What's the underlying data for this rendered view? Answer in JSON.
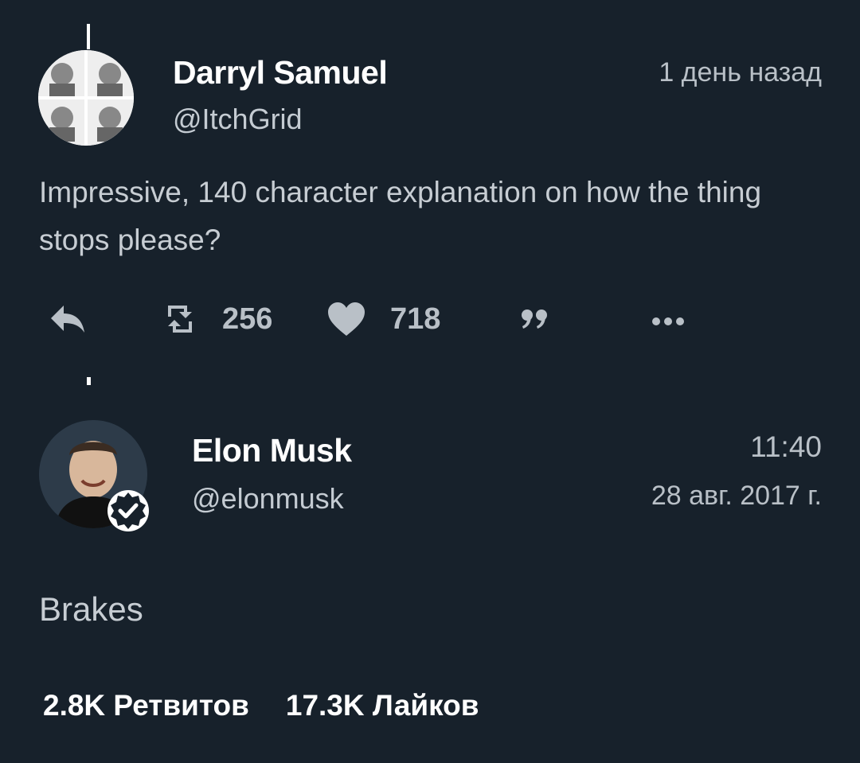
{
  "tweets": [
    {
      "author": "Darryl Samuel",
      "handle": "@ItchGrid",
      "time": "1 день назад",
      "text": "Impressive, 140 character explanation on how the thing stops please?",
      "retweets": "256",
      "likes": "718"
    },
    {
      "author": "Elon Musk",
      "handle": "@elonmusk",
      "time": "11:40",
      "date": "28 авг. 2017 г.",
      "text": "Brakes",
      "retweet_stat": "2.8K Ретвитов",
      "like_stat": "17.3K Лайков"
    }
  ],
  "icons": {
    "reply": "reply-icon",
    "retweet": "retweet-icon",
    "like": "heart-icon",
    "quote": "quote-icon",
    "more": "more-icon",
    "verified": "verified-badge-icon"
  },
  "colors": {
    "background": "#17212b",
    "primary_text": "#ffffff",
    "secondary_text": "#b9c0c7"
  }
}
